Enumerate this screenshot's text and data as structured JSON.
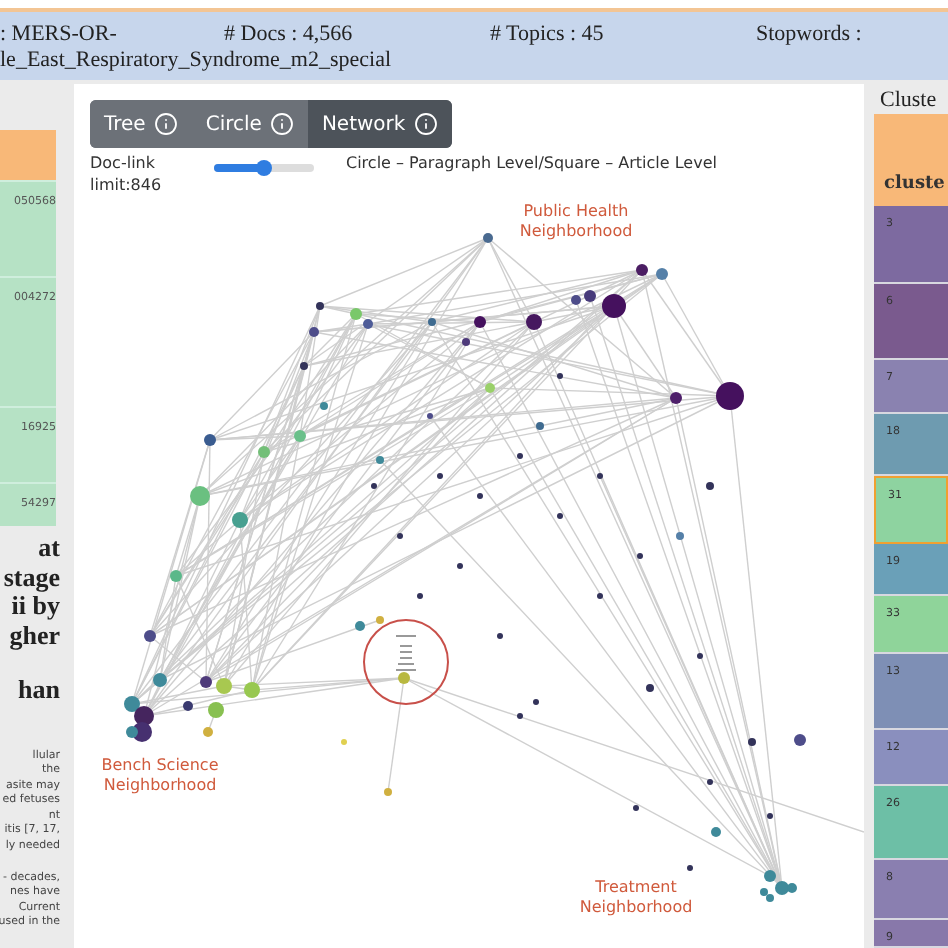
{
  "header": {
    "dataset": [
      ": MERS-OR-",
      "le_East_Respiratory_Syndrome_m2_special"
    ],
    "docs": "# Docs : 4,566",
    "topics": "# Topics : 45",
    "stopwords": "Stopwords :"
  },
  "left_panel": {
    "ids": [
      "050568",
      "004272",
      "16925",
      "54297"
    ],
    "heading_lines": [
      "at",
      "stage",
      "ii by",
      "gher"
    ],
    "heading_tail": "han",
    "excerpts": [
      [
        "llular",
        "the",
        "asite may",
        "ed fetuses",
        "nt",
        "itis [7, 17,",
        "ly needed"
      ],
      [
        "- decades,",
        "nes have",
        "Current",
        "used in the"
      ]
    ]
  },
  "toolbar": {
    "tabs": [
      {
        "label": "Tree",
        "selected": false
      },
      {
        "label": "Circle",
        "selected": false
      },
      {
        "label": "Network",
        "selected": true
      }
    ],
    "doc_link": "Doc-link limit:846",
    "slider": {
      "level": 0.5
    },
    "legend": "Circle – Paragraph Level/Square – Article Level"
  },
  "graph": {
    "labels": [
      "Public Health Neighborhood",
      "Bench Science Neighborhood",
      "Treatment Neighborhood"
    ]
  },
  "clusters": {
    "title": "Cluste",
    "column": "cluste",
    "rows": [
      {
        "label": "3",
        "color": "#7d6aa0",
        "selected": false
      },
      {
        "label": "6",
        "color": "#7a5a8e",
        "selected": false
      },
      {
        "label": "7",
        "color": "#8a82b0",
        "selected": false
      },
      {
        "label": "18",
        "color": "#6e9bb0",
        "selected": false
      },
      {
        "label": "31",
        "color": "#8ed3a0",
        "selected": true
      },
      {
        "label": "19",
        "color": "#6aa0b8",
        "selected": false
      },
      {
        "label": "33",
        "color": "#8fd49a",
        "selected": false
      },
      {
        "label": "13",
        "color": "#7e8fb5",
        "selected": false
      },
      {
        "label": "12",
        "color": "#8a8fbe",
        "selected": false
      },
      {
        "label": "26",
        "color": "#6dbfa6",
        "selected": false
      },
      {
        "label": "8",
        "color": "#8a7fb0",
        "selected": false
      },
      {
        "label": "9",
        "color": "#8878aa",
        "selected": false
      }
    ]
  }
}
